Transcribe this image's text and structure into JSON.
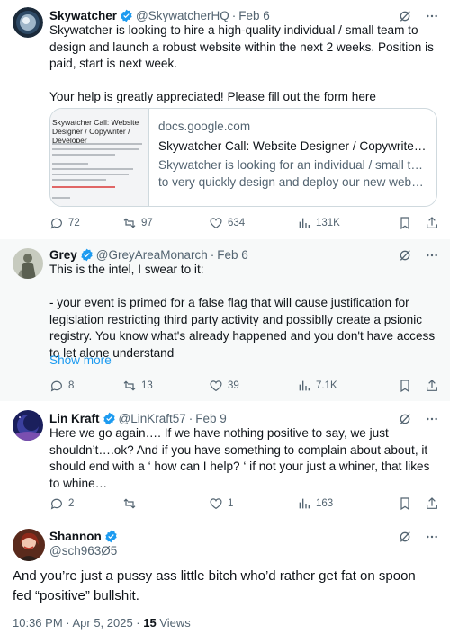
{
  "tweets": [
    {
      "name": "Skywatcher",
      "handle": "@SkywatcherHQ",
      "date": "Feb 6",
      "text": "Skywatcher is looking to hire a high-quality individual / small team to design and launch a robust website within the next 2 weeks. Position is paid, start is next week.\n\nYour help is greatly appreciated! Please fill out the form here",
      "card": {
        "thumb_title": "Skywatcher Call: Website Designer / Copywriter / Developer",
        "domain": "docs.google.com",
        "title": "Skywatcher Call: Website Designer / Copywriter / ...",
        "desc_line1": "Skywatcher is looking for an individual / small team",
        "desc_line2": "to very quickly design and deploy our new website ..."
      },
      "replies": "72",
      "reposts": "97",
      "likes": "634",
      "views": "131K"
    },
    {
      "name": "Grey",
      "handle": "@GreyAreaMonarch",
      "date": "Feb 6",
      "text": "This is the intel, I swear to it:\n\n- your event is primed for a false flag that will cause justification for legislation restricting third party activity and possiblly create a psionic registry. You know what's already happened and you don't have access to let alone understand",
      "show_more": "Show more",
      "replies": "8",
      "reposts": "13",
      "likes": "39",
      "views": "7.1K"
    },
    {
      "name": "Lin Kraft",
      "handle": "@LinKraft57",
      "date": "Feb 9",
      "text": "Here we go again…. If we have nothing positive to say, we just shouldn’t….ok? And if you have something to complain about about, it should end with a ‘ how can I help? ‘ if not your just a whiner, that likes to whine…",
      "replies": "2",
      "reposts": "",
      "likes": "1",
      "views": "163"
    }
  ],
  "main": {
    "name": "Shannon",
    "handle": "@sch963Ø5",
    "text": "And you’re just a pussy ass little bitch who’d rather get fat on spoon fed “positive” bullshit.",
    "time": "10:36 PM · Apr 5, 2025 · ",
    "views_count": "15",
    "views_label": " Views"
  },
  "colors": {
    "accent": "#1d9bf0",
    "muted": "#536471",
    "text": "#0f1419",
    "border": "#cfd9de"
  }
}
